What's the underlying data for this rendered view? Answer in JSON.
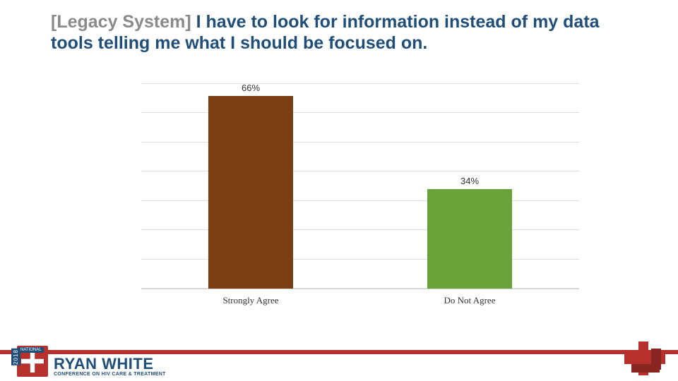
{
  "title": {
    "prefix": "[Legacy System]",
    "rest": " I have to look for information instead of my data tools telling me what I should be focused on."
  },
  "chart_data": {
    "type": "bar",
    "categories": [
      "Strongly Agree",
      "Do Not Agree"
    ],
    "values": [
      66,
      34
    ],
    "value_labels": [
      "66%",
      "34%"
    ],
    "colors": [
      "#7a3e12",
      "#6aa23a"
    ],
    "ylim": [
      0,
      70
    ],
    "gridlines": [
      0,
      10,
      20,
      30,
      40,
      50,
      60,
      70
    ],
    "title": "",
    "xlabel": "",
    "ylabel": ""
  },
  "footer": {
    "year": "2018",
    "national": "NATIONAL",
    "logo_main": "RYAN WHITE",
    "logo_sub": "CONFERENCE ON HIV CARE & TREATMENT"
  },
  "colors": {
    "title": "#1f4e79",
    "accent": "#b7312c"
  }
}
